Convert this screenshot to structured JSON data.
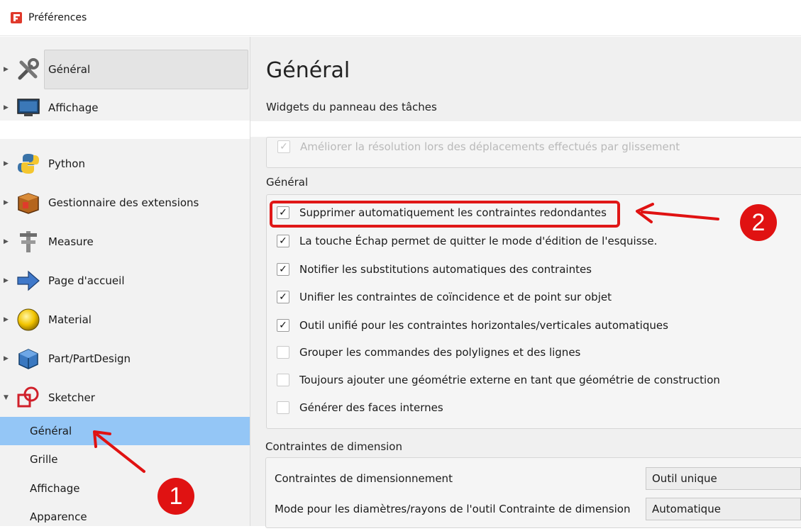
{
  "window": {
    "title": "Préférences"
  },
  "sidebar": {
    "items": [
      {
        "label": "Général",
        "icon": "tools-icon",
        "expanded": false,
        "selected": true
      },
      {
        "label": "Affichage",
        "icon": "monitor-icon",
        "expanded": false
      },
      {
        "label": "Python",
        "icon": "python-icon",
        "expanded": false
      },
      {
        "label": "Gestionnaire des extensions",
        "icon": "package-icon",
        "expanded": false
      },
      {
        "label": "Measure",
        "icon": "caliper-icon",
        "expanded": false
      },
      {
        "label": "Page d'accueil",
        "icon": "arrow-right-icon",
        "expanded": false
      },
      {
        "label": "Material",
        "icon": "sphere-icon",
        "expanded": false
      },
      {
        "label": "Part/PartDesign",
        "icon": "cube-icon",
        "expanded": false
      },
      {
        "label": "Sketcher",
        "icon": "sketcher-icon",
        "expanded": true
      }
    ],
    "sketcher_children": [
      {
        "label": "Général",
        "active": true
      },
      {
        "label": "Grille"
      },
      {
        "label": "Affichage"
      },
      {
        "label": "Apparence"
      }
    ]
  },
  "main": {
    "page_title": "Général",
    "task_widgets_label": "Widgets du panneau des tâches",
    "faded_option": "Améliorer la résolution lors des déplacements effectués par glissement",
    "general_label": "Général",
    "options": [
      {
        "label": "Supprimer automatiquement les contraintes redondantes",
        "checked": true
      },
      {
        "label": "La touche Échap permet de quitter le mode d'édition de l'esquisse.",
        "checked": true
      },
      {
        "label": "Notifier les substitutions automatiques des contraintes",
        "checked": true
      },
      {
        "label": "Unifier les contraintes de coïncidence et de point sur objet",
        "checked": true
      },
      {
        "label": "Outil unifié pour les contraintes horizontales/verticales automatiques",
        "checked": true
      },
      {
        "label": "Grouper les commandes des polylignes et des lignes",
        "checked": false
      },
      {
        "label": "Toujours ajouter une géométrie externe en tant que géométrie de construction",
        "checked": false
      },
      {
        "label": "Générer des faces internes",
        "checked": false
      }
    ],
    "dimension_label": "Contraintes de dimension",
    "dimension_rows": [
      {
        "label": "Contraintes de dimensionnement",
        "value": "Outil unique"
      },
      {
        "label": "Mode pour les diamètres/rayons de l'outil Contrainte de dimension",
        "value": "Automatique"
      }
    ]
  },
  "annotations": {
    "badge1": "1",
    "badge2": "2",
    "accent": "#e01212"
  },
  "check_mark": "✓"
}
